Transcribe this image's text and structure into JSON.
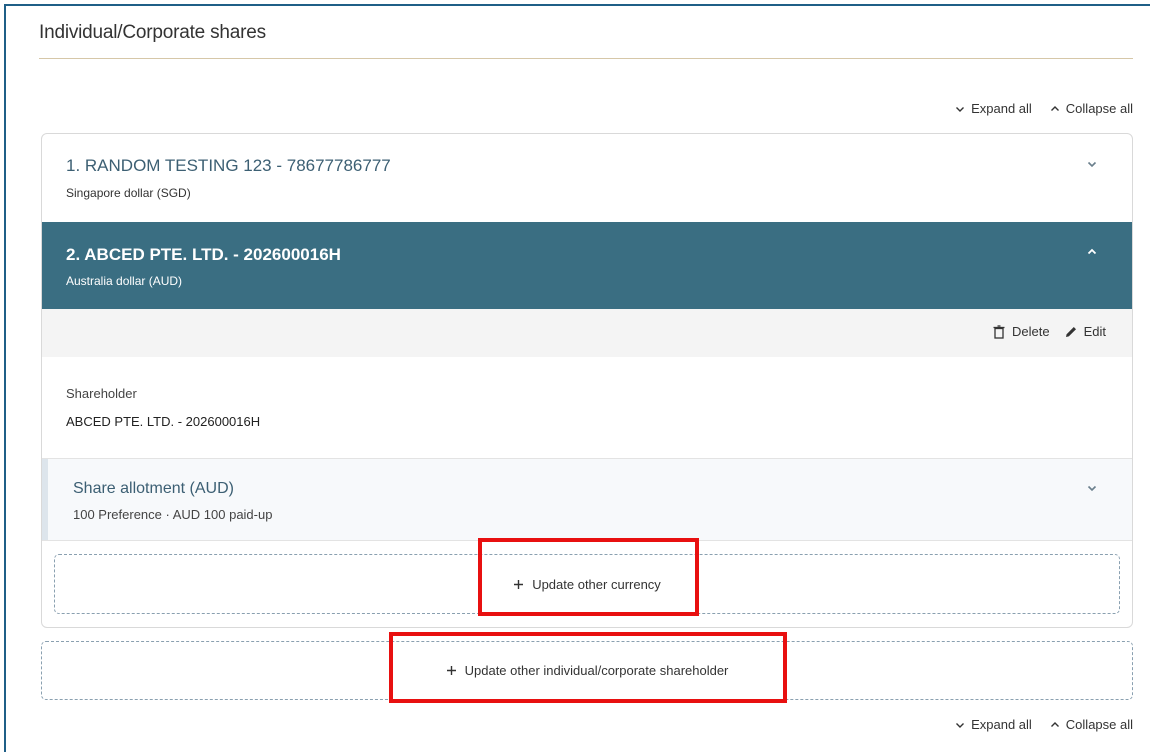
{
  "section": {
    "title": "Individual/Corporate shares"
  },
  "controls": {
    "expand_all": "Expand all",
    "collapse_all": "Collapse all"
  },
  "shareholders": [
    {
      "name": "1. RANDOM TESTING 123 - 78677786777",
      "currency": "Singapore dollar (SGD)",
      "expanded": false
    },
    {
      "name": "2. ABCED PTE. LTD. - 202600016H",
      "currency": "Australia dollar (AUD)",
      "expanded": true
    }
  ],
  "actions": {
    "delete": "Delete",
    "edit": "Edit"
  },
  "detail": {
    "shareholder_label": "Shareholder",
    "shareholder_value": "ABCED PTE. LTD. - 202600016H",
    "allotment_title": "Share allotment (AUD)",
    "allotment_summary": "100 Preference · AUD 100 paid-up"
  },
  "buttons": {
    "update_currency": "Update other currency",
    "update_shareholder": "Update other individual/corporate shareholder"
  },
  "colors": {
    "accent": "#3a6e82",
    "highlight": "#e81010",
    "title_text": "#3c5f73"
  }
}
